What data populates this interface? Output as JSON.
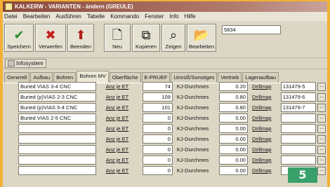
{
  "window": {
    "title": "KALKERW - VARIANTEN - ändern (GREULE)"
  },
  "menu": [
    "Datei",
    "Bearbeiten",
    "Ausführen",
    "Tabelle",
    "Kommando",
    "Fenster",
    "Info",
    "Hilfe"
  ],
  "toolbar": {
    "buttons": [
      {
        "label": "Speichern",
        "icon": "✔",
        "color": "#2e8b2e"
      },
      {
        "label": "Verwerfen",
        "icon": "✖",
        "color": "#c0201a"
      },
      {
        "label": "Beenden",
        "icon": "⬆",
        "color": "#b0201a"
      },
      {
        "label": "Neu",
        "icon": "🗋",
        "color": "#444"
      },
      {
        "label": "Kopieren",
        "icon": "⧉",
        "color": "#444"
      },
      {
        "label": "Zeigen",
        "icon": "⌕",
        "color": "#444"
      },
      {
        "label": "Bearbeiten",
        "icon": "📂",
        "color": "#444"
      }
    ],
    "search_value": "5834"
  },
  "info_button": "Infosystem",
  "tabs": [
    "Generell",
    "Aufbau",
    "Bohren",
    "Bohren MV",
    "Oberfläche",
    "E-PRUEF",
    "Umrüß/Sonstiges",
    "Vertrieb",
    "Lagenaufbau"
  ],
  "active_tab": "Bohren MV",
  "labels": {
    "anz": "Anz je ET",
    "kj": "KJ-Durchmes",
    "drill": "Drillmap",
    "dots": "..."
  },
  "rows": [
    {
      "name": "Buried VIAS 3-4 CNC",
      "anz": "74",
      "kj": "0.20",
      "drill": "131479-5"
    },
    {
      "name": "Buried (p)VIAS 2-3 CNC",
      "anz": "109",
      "kj": "0.80",
      "drill": "131479-6"
    },
    {
      "name": "Buried (p)VIAS 5-4 CNC",
      "anz": "101",
      "kj": "0.80",
      "drill": "131479-7"
    },
    {
      "name": "Buried VIAS 2-5 CNC",
      "anz": "0",
      "kj": "0.00",
      "drill": ""
    },
    {
      "name": "",
      "anz": "0",
      "kj": "0.00",
      "drill": ""
    },
    {
      "name": "",
      "anz": "0",
      "kj": "0.00",
      "drill": ""
    },
    {
      "name": "",
      "anz": "0",
      "kj": "0.00",
      "drill": ""
    },
    {
      "name": "",
      "anz": "0",
      "kj": "0.00",
      "drill": ""
    },
    {
      "name": "",
      "anz": "0",
      "kj": "0.00",
      "drill": ""
    }
  ],
  "badge": "5"
}
